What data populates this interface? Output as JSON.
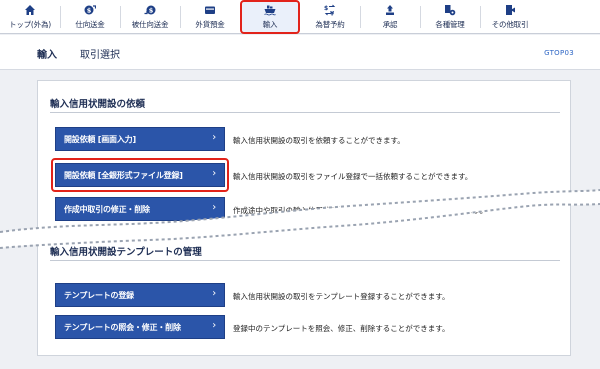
{
  "nav": {
    "items": [
      {
        "label": "トップ(外為)",
        "icon": "home-icon"
      },
      {
        "label": "仕向送金",
        "icon": "outward-remittance-icon"
      },
      {
        "label": "被仕向送金",
        "icon": "inward-remittance-icon"
      },
      {
        "label": "外貨預金",
        "icon": "deposit-icon"
      },
      {
        "label": "輸入",
        "icon": "import-ship-icon",
        "active": true
      },
      {
        "label": "為替予約",
        "icon": "fx-contract-icon"
      },
      {
        "label": "承認",
        "icon": "approval-icon"
      },
      {
        "label": "各種管理",
        "icon": "management-icon"
      },
      {
        "label": "その他取引",
        "icon": "other-transactions-icon"
      }
    ]
  },
  "header": {
    "title": "輸入",
    "subtitle": "取引選択",
    "screen_id": "GTOP03"
  },
  "section1": {
    "title": "輸入信用状開設の依頼",
    "buttons": [
      {
        "label": "開設依頼 [画面入力]",
        "description": "輸入信用状開設の取引を依頼することができます。"
      },
      {
        "label": "開設依頼 [全銀形式ファイル登録]",
        "description": "輸入信用状開設の取引をファイル登録で一括依頼することができます。"
      },
      {
        "label": "作成中取引の修正・削除",
        "description": "作成途中や取引の輸入信用状開設の取引を修正、削除することができます。"
      }
    ]
  },
  "section2": {
    "title": "輸入信用状開設テンプレートの管理",
    "buttons": [
      {
        "label": "テンプレートの登録",
        "description": "輸入信用状開設の取引をテンプレート登録することができます。"
      },
      {
        "label": "テンプレートの照会・修正・削除",
        "description": "登録中のテンプレートを照会、修正、削除することができます。"
      }
    ]
  },
  "colors": {
    "button_blue": "#2b55a9",
    "highlight_red": "#e2231a",
    "nav_text": "#1e2e54",
    "screen_id_blue": "#2e66c5"
  }
}
